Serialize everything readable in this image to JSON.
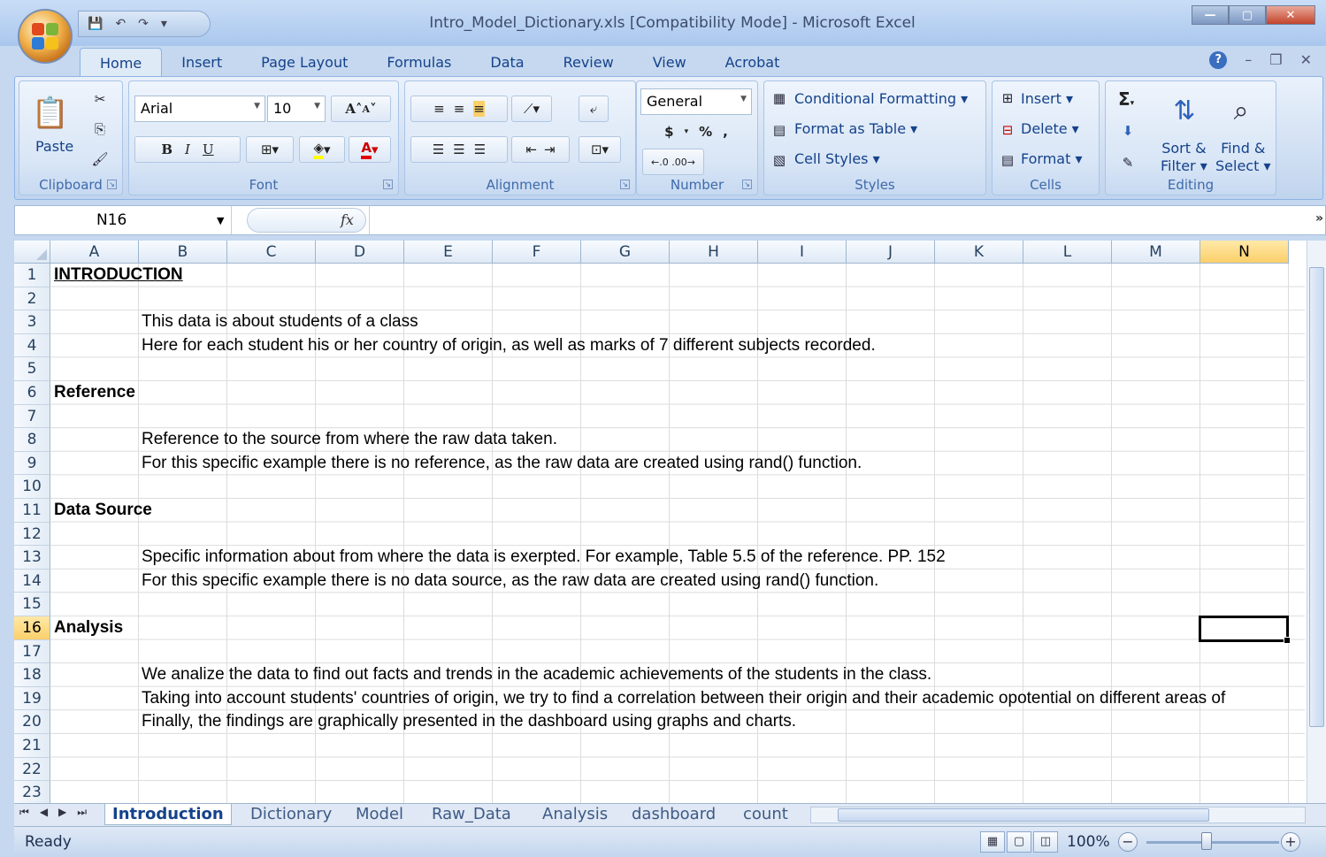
{
  "window": {
    "title": "Intro_Model_Dictionary.xls  [Compatibility Mode] - Microsoft Excel"
  },
  "ribbon": {
    "tabs": [
      "Home",
      "Insert",
      "Page Layout",
      "Formulas",
      "Data",
      "Review",
      "View",
      "Acrobat"
    ],
    "clipboard": {
      "paste": "Paste",
      "label": "Clipboard"
    },
    "font": {
      "name": "Arial",
      "size": "10",
      "bold": "B",
      "italic": "I",
      "underline": "U",
      "grow": "A",
      "shrink": "A",
      "color_letter": "A",
      "label": "Font"
    },
    "alignment": {
      "label": "Alignment"
    },
    "number": {
      "format": "General",
      "currency": "$",
      "percent": "%",
      "comma": ",",
      "label": "Number"
    },
    "styles": {
      "conditional": "Conditional Formatting",
      "format_table": "Format as Table",
      "cell_styles": "Cell Styles",
      "label": "Styles"
    },
    "cells": {
      "insert": "Insert",
      "delete": "Delete",
      "format": "Format",
      "label": "Cells"
    },
    "editing": {
      "sigma": "Σ",
      "sort": "Sort &",
      "sort2": "Filter",
      "find": "Find &",
      "find2": "Select",
      "label": "Editing"
    }
  },
  "formula_bar": {
    "name_box": "N16",
    "fx": "fx",
    "value": ""
  },
  "grid": {
    "columns": [
      "A",
      "B",
      "C",
      "D",
      "E",
      "F",
      "G",
      "H",
      "I",
      "J",
      "K",
      "L",
      "M",
      "N"
    ],
    "rows": [
      "1",
      "2",
      "3",
      "4",
      "5",
      "6",
      "7",
      "8",
      "9",
      "10",
      "11",
      "12",
      "13",
      "14",
      "15",
      "16",
      "17",
      "18",
      "19",
      "20",
      "21",
      "22",
      "23"
    ],
    "cells": {
      "r1": "INTRODUCTION",
      "r3": "This data is about students of a class",
      "r4": "Here for each student his or her country of origin, as well as marks of 7 different subjects recorded.",
      "r6": "Reference",
      "r8": "Reference to the source from where the raw data taken.",
      "r9": "For this specific example there is no reference, as the raw data are created using rand() function.",
      "r11": "Data Source",
      "r13": "Specific information about from where the data is exerpted. For example, Table 5.5 of the reference. PP. 152",
      "r14": "For this specific example there is no data source, as the raw data are created using rand() function.",
      "r16": "Analysis",
      "r18": "We analize the data to find out facts and trends in the academic achievements of the students in the class.",
      "r19": "Taking into account students' countries of origin, we try to find a correlation between their origin and their academic opotential on different areas of",
      "r20": "Finally, the findings are graphically presented in the dashboard using graphs and charts."
    }
  },
  "sheets": [
    "Introduction",
    "Dictionary",
    "Model",
    "Raw_Data",
    "Analysis",
    "dashboard",
    "count"
  ],
  "status": {
    "text": "Ready",
    "zoom": "100%",
    "minus": "−",
    "plus": "+"
  }
}
